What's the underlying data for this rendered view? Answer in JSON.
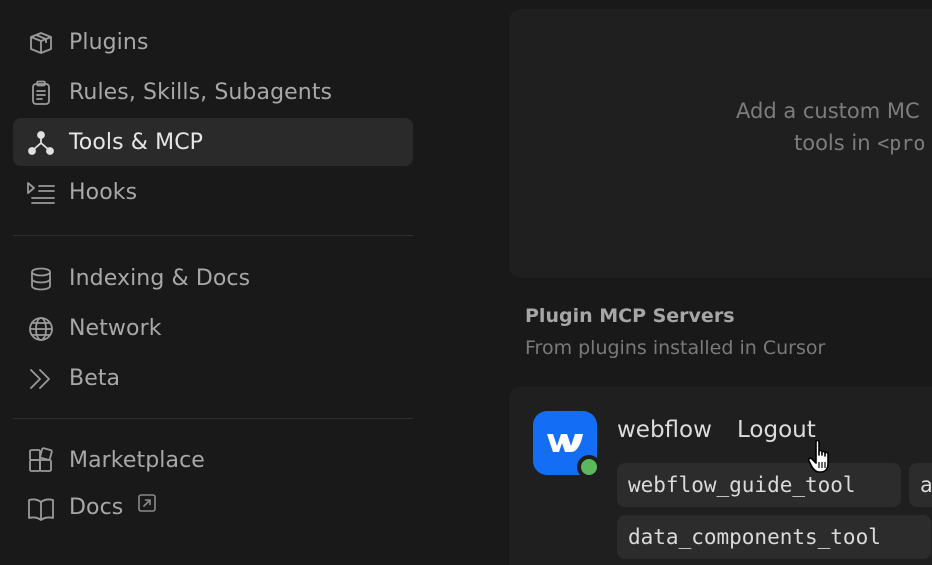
{
  "sidebar": {
    "group1": [
      {
        "label": "Plugins",
        "icon": "package-icon"
      },
      {
        "label": "Rules, Skills, Subagents",
        "icon": "clipboard-icon"
      },
      {
        "label": "Tools & MCP",
        "icon": "mcp-icon",
        "active": true
      },
      {
        "label": "Hooks",
        "icon": "hooks-icon"
      }
    ],
    "group2": [
      {
        "label": "Indexing & Docs",
        "icon": "database-icon"
      },
      {
        "label": "Network",
        "icon": "globe-icon"
      },
      {
        "label": "Beta",
        "icon": "chevrons-right-icon"
      }
    ],
    "group3": [
      {
        "label": "Marketplace",
        "icon": "marketplace-icon"
      },
      {
        "label": "Docs",
        "icon": "book-icon",
        "external": true
      }
    ]
  },
  "main": {
    "empty_state": {
      "line1": "Add a custom MC",
      "line2_prefix": "tools in ",
      "line2_code": "<pro"
    },
    "plugin_section": {
      "title": "Plugin MCP Servers",
      "subtitle": "From plugins installed in Cursor"
    },
    "server": {
      "name": "webflow",
      "action_label": "Logout",
      "status_color": "#5cb85c",
      "logo_color": "#146ef5",
      "tools": [
        "webflow_guide_tool",
        "a",
        "data_components_tool"
      ]
    }
  },
  "colors": {
    "background": "#191919",
    "card": "#1f1f1f",
    "active_item": "#2a2a2a",
    "chip": "#2c2c2c"
  }
}
